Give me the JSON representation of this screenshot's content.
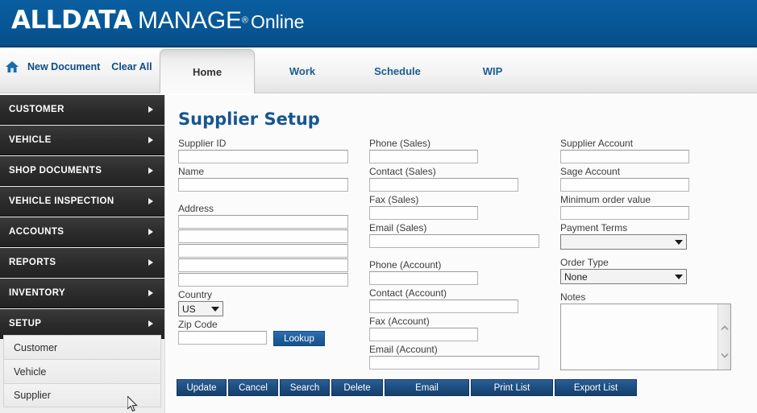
{
  "header": {
    "logo_brand": "ALLDATA",
    "logo_product": "MANAGE",
    "logo_tm": "®",
    "logo_suffix": "Online",
    "brand_color": "#075796"
  },
  "toolbar": {
    "home_icon": "home-icon",
    "new_document": "New Document",
    "clear_all": "Clear All"
  },
  "tabs": [
    {
      "label": "Home",
      "active": true
    },
    {
      "label": "Work",
      "active": false
    },
    {
      "label": "Schedule",
      "active": false
    },
    {
      "label": "WIP",
      "active": false
    }
  ],
  "sidebar": {
    "items": [
      {
        "label": "CUSTOMER"
      },
      {
        "label": "VEHICLE"
      },
      {
        "label": "SHOP DOCUMENTS"
      },
      {
        "label": "VEHICLE INSPECTION"
      },
      {
        "label": "ACCOUNTS"
      },
      {
        "label": "REPORTS"
      },
      {
        "label": "INVENTORY"
      },
      {
        "label": "SETUP"
      }
    ],
    "submenu": [
      {
        "label": "Customer"
      },
      {
        "label": "Vehicle"
      },
      {
        "label": "Supplier"
      }
    ]
  },
  "main": {
    "title": "Supplier Setup",
    "column_left": {
      "supplier_id_label": "Supplier ID",
      "supplier_id_value": "",
      "name_label": "Name",
      "name_value": "",
      "address_label": "Address",
      "address_lines": [
        "",
        "",
        "",
        "",
        ""
      ],
      "country_label": "Country",
      "country_value": "US",
      "country_options": [
        "US"
      ],
      "zip_label": "Zip Code",
      "zip_value": "",
      "lookup_label": "Lookup"
    },
    "column_mid": {
      "phone_sales_label": "Phone (Sales)",
      "phone_sales_value": "",
      "contact_sales_label": "Contact (Sales)",
      "contact_sales_value": "",
      "fax_sales_label": "Fax (Sales)",
      "fax_sales_value": "",
      "email_sales_label": "Email (Sales)",
      "email_sales_value": "",
      "phone_account_label": "Phone (Account)",
      "phone_account_value": "",
      "contact_account_label": "Contact (Account)",
      "contact_account_value": "",
      "fax_account_label": "Fax (Account)",
      "fax_account_value": "",
      "email_account_label": "Email (Account)",
      "email_account_value": ""
    },
    "column_right": {
      "supplier_account_label": "Supplier Account",
      "supplier_account_value": "",
      "sage_account_label": "Sage Account",
      "sage_account_value": "",
      "min_order_label": "Minimum order value",
      "min_order_value": "",
      "payment_terms_label": "Payment Terms",
      "payment_terms_value": "",
      "order_type_label": "Order Type",
      "order_type_value": "None",
      "order_type_options": [
        "None"
      ],
      "notes_label": "Notes",
      "notes_value": ""
    }
  },
  "buttons": [
    {
      "label": "Update"
    },
    {
      "label": "Cancel"
    },
    {
      "label": "Search"
    },
    {
      "label": "Delete"
    },
    {
      "label": "Email"
    },
    {
      "label": "Print List"
    },
    {
      "label": "Export List"
    }
  ]
}
